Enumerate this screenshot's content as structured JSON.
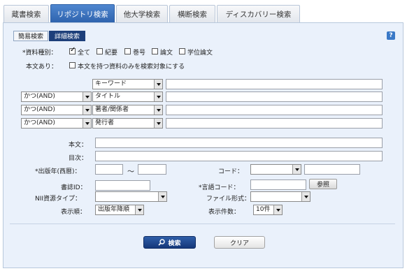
{
  "tabs": [
    "蔵書検索",
    "リポジトリ検索",
    "他大学検索",
    "横断検索",
    "ディスカバリー検索"
  ],
  "subtabs": {
    "simple": "簡易検索",
    "detail": "詳細検索"
  },
  "help": "?",
  "material": {
    "label": "*資料種別：",
    "options": [
      "全て",
      "紀要",
      "巻号",
      "論文",
      "学位論文"
    ],
    "checked": [
      true,
      false,
      false,
      false,
      false
    ]
  },
  "fulltext": {
    "label": "本文あり：",
    "option": "本文を持つ資料のみを検索対象にする"
  },
  "search_rows": [
    {
      "op": "",
      "field": "キーワード"
    },
    {
      "op": "かつ(AND)",
      "field": "タイトル"
    },
    {
      "op": "かつ(AND)",
      "field": "著者/関係者"
    },
    {
      "op": "かつ(AND)",
      "field": "発行者"
    }
  ],
  "fields": {
    "body": "本文：",
    "toc": "目次：",
    "pubyear": "*出版年(西暦)：",
    "tilde": "〜",
    "code": "コード：",
    "bibid": "書誌ID：",
    "langcode": "*言語コード：",
    "nii_type": "NII資源タイプ：",
    "file_format": "ファイル形式：",
    "sort_order": "表示順：",
    "count": "表示件数："
  },
  "sort_value": "出版年降順",
  "count_value": "10件",
  "buttons": {
    "ref": "参照",
    "search": "検索",
    "clear": "クリア"
  },
  "colors": {
    "active_tab": "#2d62ad",
    "panel_bg": "#eaf1fb",
    "search_button": "#15387a"
  }
}
